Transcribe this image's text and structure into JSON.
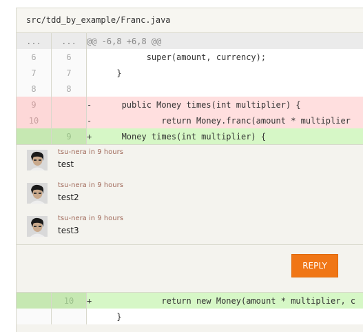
{
  "file": {
    "path": "src/tdd_by_example/Franc.java"
  },
  "hunk": {
    "old": "...",
    "new": "...",
    "header": "@@ -6,8 +6,8 @@"
  },
  "lines": [
    {
      "type": "ctx",
      "old": "6",
      "new": "6",
      "code": "            super(amount, currency);"
    },
    {
      "type": "ctx",
      "old": "7",
      "new": "7",
      "code": "      }"
    },
    {
      "type": "ctx",
      "old": "8",
      "new": "8",
      "code": ""
    },
    {
      "type": "del",
      "old": "9",
      "new": "",
      "code": "-      public Money times(int multiplier) {"
    },
    {
      "type": "del",
      "old": "10",
      "new": "",
      "code": "-              return Money.franc(amount * multiplier"
    },
    {
      "type": "add",
      "old": "",
      "new": "9",
      "code": "+      Money times(int multiplier) {"
    }
  ],
  "comments": [
    {
      "author_time": "tsu-nera in 9 hours",
      "text": "test"
    },
    {
      "author_time": "tsu-nera in 9 hours",
      "text": "test2"
    },
    {
      "author_time": "tsu-nera in 9 hours",
      "text": "test3"
    }
  ],
  "reply": {
    "label": "REPLY"
  },
  "after_lines": [
    {
      "type": "add",
      "old": "",
      "new": "10",
      "code": "+              return new Money(amount * multiplier, c"
    },
    {
      "type": "ctx",
      "old": "",
      "new": "",
      "code": "      }"
    }
  ]
}
